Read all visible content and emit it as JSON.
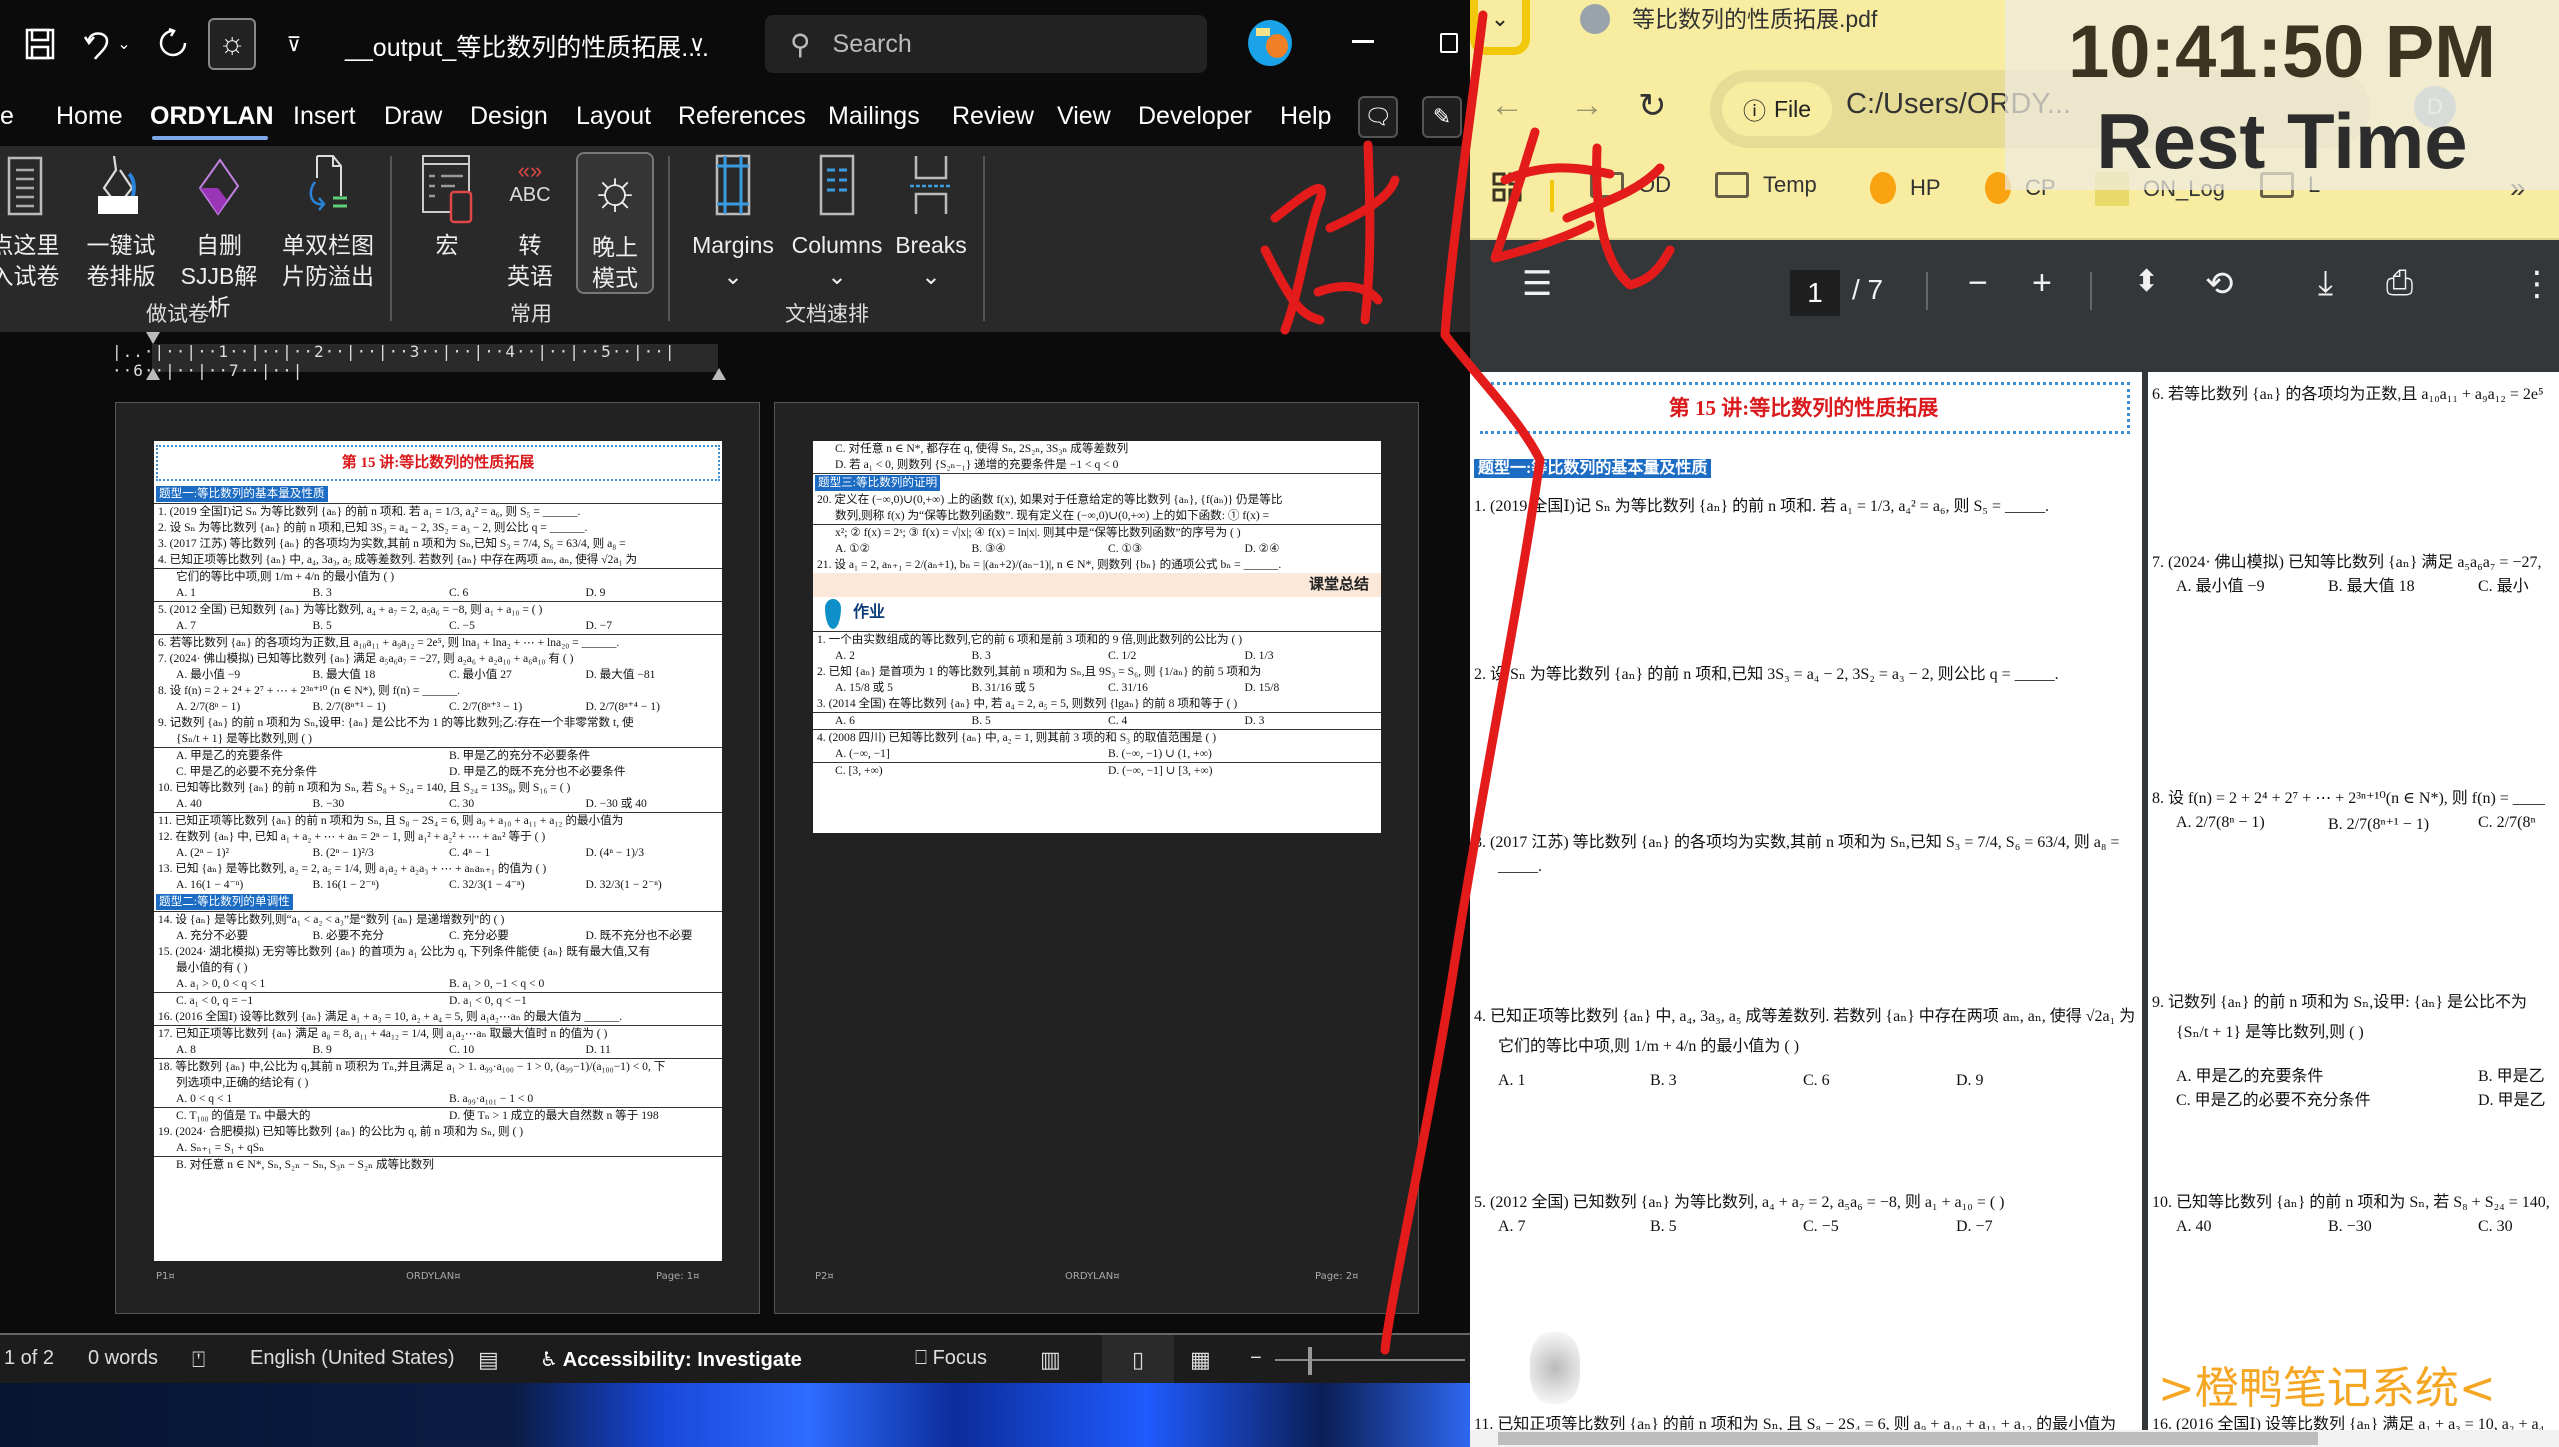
{
  "word": {
    "quick_access": {
      "save_icon": "save-icon",
      "undo_icon": "undo-icon",
      "redo_icon": "redo-icon",
      "sun_icon": "sun-icon",
      "customize_icon": "customize-icon"
    },
    "title": "__output_等比数列的性质拓展....",
    "search_placeholder": "Search",
    "menu": [
      "e",
      "Home",
      "ORDYLAN",
      "Insert",
      "Draw",
      "Design",
      "Layout",
      "References",
      "Mailings",
      "Review",
      "View",
      "Developer",
      "Help"
    ],
    "active_menu": "ORDYLAN",
    "ribbon": {
      "groups": [
        {
          "label": "做试卷",
          "buttons": [
            {
              "line1": "点这里",
              "line2": "入试卷"
            },
            {
              "line1": "一键试",
              "line2": "卷排版"
            },
            {
              "line1": "自删",
              "line2": "SJJB解析"
            },
            {
              "line1": "单双栏图",
              "line2": "片防溢出"
            }
          ]
        },
        {
          "label": "常用",
          "buttons": [
            {
              "line1": "宏",
              "line2": ""
            },
            {
              "line1": "转",
              "line2": "英语"
            },
            {
              "line1": "晚上",
              "line2": "模式"
            }
          ]
        },
        {
          "label": "文档速排",
          "buttons": [
            {
              "line1": "Margins",
              "line2": "⌄"
            },
            {
              "line1": "Columns",
              "line2": "⌄"
            },
            {
              "line1": "Breaks",
              "line2": "⌄"
            }
          ]
        }
      ]
    },
    "ruler_text": "|..·|··|··1··|··|··2··|··|··3··|··|··4··|··|··5··|··|··6··|··|··7··|··|",
    "page1": {
      "header": "第 15 讲:等比数列的性质拓展",
      "section1": "题型一:等比数列的基本量及性质",
      "lines": [
        "1. (2019 全国Ⅰ)记 Sₙ 为等比数列 {aₙ} 的前 n 项和. 若 a₁ = 1/3, a₄² = a₆, 则 S₅ = ______.",
        "2. 设 Sₙ 为等比数列 {aₙ} 的前 n 项和,已知 3S₃ = a₄ − 2, 3S₂ = a₃ − 2, 则公比 q = ______.",
        "3. (2017 江苏) 等比数列 {aₙ} 的各项均为实数,其前 n 项和为 Sₙ,已知 S₃ = 7/4, S₆ = 63/4, 则 a₈ =",
        "4. 已知正项等比数列 {aₙ} 中, a₄, 3a₃, a₅ 成等差数列. 若数列 {aₙ} 中存在两项 aₘ, aₙ, 使得 √2a₁ 为",
        "它们的等比中项,则 1/m + 4/n 的最小值为 (   )"
      ],
      "q4_opts": [
        "A. 1",
        "B. 3",
        "C. 6",
        "D. 9"
      ],
      "q5": "5. (2012 全国) 已知数列 {aₙ} 为等比数列, a₄ + a₇ = 2, a₅a₆ = −8, 则 a₁ + a₁₀ = (   )",
      "q5_opts": [
        "A. 7",
        "B. 5",
        "C. −5",
        "D. −7"
      ],
      "q6": "6. 若等比数列 {aₙ} 的各项均为正数,且 a₁₀a₁₁ + a₉a₁₂ = 2e⁵, 则 lna₁ + lna₂ + ⋯ + lna₂₀ = ______.",
      "q7": "7. (2024· 佛山模拟) 已知等比数列 {aₙ} 满足 a₅a₆a₇ = −27, 则 a₂a₆ + a₂a₁₀ + a₆a₁₀ 有 (   )",
      "q7_opts": [
        "A. 最小值 −9",
        "B. 最大值 18",
        "C. 最小值 27",
        "D. 最大值 −81"
      ],
      "q8": "8. 设 f(n) = 2 + 2⁴ + 2⁷ + ⋯ + 2³ⁿ⁺¹⁰ (n ∈ N*), 则 f(n) = ______.",
      "q8_opts": [
        "A. 2/7(8ⁿ − 1)",
        "B. 2/7(8ⁿ⁺¹ − 1)",
        "C. 2/7(8ⁿ⁺³ − 1)",
        "D. 2/7(8ⁿ⁺⁴ − 1)"
      ],
      "q9a": "9. 记数列 {aₙ} 的前 n 项和为 Sₙ,设甲: {aₙ} 是公比不为 1 的等比数列;乙:存在一个非零常数 t, 使",
      "q9b": "{Sₙ/t + 1} 是等比数列,则 (   )",
      "q9_opts": [
        "A. 甲是乙的充要条件",
        "B. 甲是乙的充分不必要条件",
        "C. 甲是乙的必要不充分条件",
        "D. 甲是乙的既不充分也不必要条件"
      ],
      "q10": "10. 已知等比数列 {aₙ} 的前 n 项和为 Sₙ, 若 S₈ + S₂₄ = 140, 且 S₂₄ = 13S₈, 则 S₁₆ = (   )",
      "q10_opts": [
        "A. 40",
        "B. −30",
        "C. 30",
        "D. −30 或 40"
      ],
      "q11": "11. 已知正项等比数列 {aₙ} 的前 n 项和为 Sₙ, 且 S₈ − 2S₄ = 6, 则 a₉ + a₁₀ + a₁₁ + a₁₂ 的最小值为",
      "q12": "12. 在数列 {aₙ} 中, 已知 a₁ + a₂ + ⋯ + aₙ = 2ⁿ − 1, 则 a₁² + a₂² + ⋯ + aₙ² 等于 (   )",
      "q12_opts": [
        "A. (2ⁿ − 1)²",
        "B. (2ⁿ − 1)²/3",
        "C. 4ⁿ − 1",
        "D. (4ⁿ − 1)/3"
      ],
      "q13": "13. 已知 {aₙ} 是等比数列, a₂ = 2, a₅ = 1/4, 则 a₁a₂ + a₂a₃ + ⋯ + aₙaₙ₊₁ 的值为 (   )",
      "q13_opts": [
        "A. 16(1 − 4⁻ⁿ)",
        "B. 16(1 − 2⁻ⁿ)",
        "C. 32/3(1 − 4⁻ⁿ)",
        "D. 32/3(1 − 2⁻ⁿ)"
      ],
      "section2": "题型二:等比数列的单调性",
      "q14": "14. 设 {aₙ} 是等比数列,则“a₁ < a₂ < a₃”是“数列 {aₙ} 是递增数列”的 (   )",
      "q14_opts": [
        "A. 充分不必要",
        "B. 必要不充分",
        "C. 充分必要",
        "D. 既不充分也不必要"
      ],
      "q15a": "15. (2024· 湖北模拟) 无穷等比数列 {aₙ} 的首项为 a₁ 公比为 q, 下列条件能使 {aₙ} 既有最大值,又有",
      "q15b": "最小值的有 (   )",
      "q15_opts": [
        "A. a₁ > 0, 0 < q < 1",
        "B. a₁ > 0, −1 < q < 0",
        "C. a₁ < 0, q = −1",
        "D. a₁ < 0, q < −1"
      ],
      "q16": "16. (2016 全国Ⅰ) 设等比数列 {aₙ} 满足 a₁ + a₃ = 10, a₂ + a₄ = 5, 则 a₁a₂⋯aₙ 的最大值为 ______.",
      "q17": "17. 已知正项等比数列 {aₙ} 满足 a₈ = 8, a₁₁ + 4a₁₂ = 1/4, 则 a₁a₂⋯aₙ 取最大值时 n 的值为 (   )",
      "q17_opts": [
        "A. 8",
        "B. 9",
        "C. 10",
        "D. 11"
      ],
      "q18a": "18. 等比数列 {aₙ} 中,公比为 q,其前 n 项积为 Tₙ,并且满足 a₁ > 1. a₉₉·a₁₀₀ − 1 > 0, (a₉₉−1)/(a₁₀₀−1) < 0, 下",
      "q18b": "列选项中,正确的结论有 (   )",
      "q18_opts": [
        "A. 0 < q < 1",
        "B. a₉₉·a₁₀₁ − 1 < 0",
        "C. T₁₀₀ 的值是 Tₙ 中最大的",
        "D. 使 Tₙ > 1 成立的最大自然数 n 等于 198"
      ],
      "q19": "19. (2024· 合肥模拟) 已知等比数列 {aₙ} 的公比为 q, 前 n 项和为 Sₙ, 则 (   )",
      "q19a": "A. Sₙ₊₁ = S₁ + qSₙ",
      "q19b": "B. 对任意 n ∈ N*, Sₙ, S₂ₙ − Sₙ, S₃ₙ − S₂ₙ 成等比数列",
      "footer_left": "P1¤",
      "footer_center": "ORDYLAN¤",
      "footer_right": "Page: 1¤"
    },
    "page2": {
      "l1": "C. 对任意 n ∈ N*, 都存在 q, 使得 Sₙ, 2S₂ₙ, 3S₃ₙ 成等差数列",
      "l2": "D. 若 a₁ < 0, 则数列 {S₂ₙ₋₁} 递增的充要条件是 −1 < q < 0",
      "section3": "题型三:等比数列的证明",
      "q20a": "20. 定义在 (−∞,0)∪(0,+∞) 上的函数 f(x), 如果对于任意给定的等比数列 {aₙ}, {f(aₙ)} 仍是等比",
      "q20b": "数列,则称 f(x) 为“保等比数列函数”. 现有定义在 (−∞,0)∪(0,+∞) 上的如下函数: ① f(x) =",
      "q20c": "x²; ② f(x) = 2ˣ; ③ f(x) = √|x|; ④ f(x) = ln|x|. 则其中是“保等比数列函数”的序号为 (   )",
      "q20_opts": [
        "A. ①②",
        "B. ③④",
        "C. ①③",
        "D. ②④"
      ],
      "q21": "21. 设 a₁ = 2, aₙ₊₁ = 2/(aₙ+1), bₙ = |(aₙ+2)/(aₙ−1)|, n ∈ N*, 则数列 {bₙ} 的通项公式 bₙ = ______.",
      "summary": "课堂总结",
      "homework": "作业",
      "h1": "1. 一个由实数组成的等比数列,它的前 6 项和是前 3 项和的 9 倍,则此数列的公比为 (   )",
      "h1_opts": [
        "A. 2",
        "B. 3",
        "C. 1/2",
        "D. 1/3"
      ],
      "h2": "2. 已知 {aₙ} 是首项为 1 的等比数列,其前 n 项和为 Sₙ,且 9S₃ = S₆, 则 {1/aₙ} 的前 5 项和为",
      "h2_opts": [
        "A. 15/8 或 5",
        "B. 31/16 或 5",
        "C. 31/16",
        "D. 15/8"
      ],
      "h3": "3. (2014 全国) 在等比数列 {aₙ} 中, 若 a₄ = 2, a₅ = 5, 则数列 {lgaₙ} 的前 8 项和等于 (   )",
      "h3_opts": [
        "A. 6",
        "B. 5",
        "C. 4",
        "D. 3"
      ],
      "h4": "4. (2008 四川) 已知等比数列 {aₙ} 中, a₂ = 1, 则其前 3 项的和 S₃ 的取值范围是 (   )",
      "h4_opts": [
        "A. (−∞, −1]",
        "B. (−∞, −1) ∪ (1, +∞)",
        "C. [3, +∞)",
        "D. (−∞, −1] ∪ [3, +∞)"
      ],
      "footer_left": "P2¤",
      "footer_center": "ORDYLAN¤",
      "footer_right": "Page: 2¤"
    },
    "status": {
      "page": "1 of 2",
      "words": "0 words",
      "language": "English (United States)",
      "accessibility": "Accessibility: Investigate",
      "focus": "Focus"
    }
  },
  "browser": {
    "tab_title": "等比数列的性质拓展.pdf",
    "address_chip": "File",
    "address_url": "C:/Users/ORDY...",
    "profile_initial": "D",
    "bookmarks": [
      "OD",
      "Temp",
      "HP",
      "CP",
      "ON_Log",
      "L"
    ],
    "more_bookmarks": "»"
  },
  "overlay": {
    "time": "10:41:50 PM",
    "label": "Rest Time"
  },
  "pdf": {
    "current_page": "1",
    "total_pages": "/ 7",
    "page_left": {
      "header": "第 15 讲:等比数列的性质拓展",
      "section1": "题型一:等比数列的基本量及性质",
      "q1": "1. (2019 全国Ⅰ)记 Sₙ 为等比数列 {aₙ} 的前 n 项和. 若 a₁ = 1/3, a₄² = a₆, 则 S₅ = _____.",
      "q2": "2. 设 Sₙ 为等比数列 {aₙ} 的前 n 项和,已知 3S₃ = a₄ − 2, 3S₂ = a₃ − 2, 则公比 q = _____.",
      "q3": "3. (2017 江苏) 等比数列 {aₙ} 的各项均为实数,其前 n 项和为 Sₙ,已知 S₃ = 7/4, S₆ = 63/4, 则 a₈ =",
      "q3_blank": "_____.",
      "q4": "4. 已知正项等比数列 {aₙ} 中, a₄, 3a₃, a₅ 成等差数列. 若数列 {aₙ} 中存在两项 aₘ, aₙ, 使得 √2a₁ 为",
      "q4b": "它们的等比中项,则 1/m + 4/n 的最小值为 (   )",
      "q4_opts": [
        "A. 1",
        "B. 3",
        "C. 6",
        "D. 9"
      ],
      "q5": "5. (2012 全国) 已知数列 {aₙ} 为等比数列, a₄ + a₇ = 2, a₅a₆ = −8, 则 a₁ + a₁₀ = (   )",
      "q5_opts": [
        "A. 7",
        "B. 5",
        "C. −5",
        "D. −7"
      ],
      "q11": "11. 已知正项等比数列 {aₙ} 的前 n 项和为 Sₙ, 且 S₈ − 2S₄ = 6, 则 a₉ + a₁₀ + a₁₁ + a₁₂ 的最小值为"
    },
    "page_right": {
      "q6": "6. 若等比数列 {aₙ} 的各项均为正数,且 a₁₀a₁₁ + a₉a₁₂ = 2e⁵",
      "q7": "7. (2024· 佛山模拟) 已知等比数列 {aₙ} 满足 a₅a₆a₇ = −27,",
      "q7_opts": [
        "A. 最小值 −9",
        "B. 最大值 18",
        "C. 最小"
      ],
      "q8": "8. 设 f(n) = 2 + 2⁴ + 2⁷ + ⋯ + 2³ⁿ⁺¹⁰(n ∈ N*), 则 f(n) = ____",
      "q8_opts": [
        "A. 2/7(8ⁿ − 1)",
        "B. 2/7(8ⁿ⁺¹ − 1)",
        "C. 2/7(8ⁿ"
      ],
      "q9": "9. 记数列 {aₙ} 的前 n 项和为 Sₙ,设甲: {aₙ} 是公比不为",
      "q9b": "{Sₙ/t + 1} 是等比数列,则 (   )",
      "q9_opts": [
        "A. 甲是乙的充要条件",
        "B. 甲是乙",
        "C. 甲是乙的必要不充分条件",
        "D. 甲是乙"
      ],
      "q10": "10. 已知等比数列 {aₙ} 的前 n 项和为 Sₙ, 若 S₈ + S₂₄ = 140,",
      "q10_opts": [
        "A. 40",
        "B. −30",
        "C. 30"
      ],
      "brand": ">橙鸭笔记系统<",
      "q16": "16. (2016 全国Ⅰ) 设等比数列 {aₙ} 满足 a₁ + a₃ = 10, a₂ + a₄"
    }
  },
  "annotation": {
    "ink_color": "#e31b1b",
    "handwriting": "对比"
  },
  "colors": {
    "accent_blue": "#1c6cc4",
    "header_red": "#d9191c",
    "brand_orange": "#f5a623",
    "browser_theme": "#f8eca0"
  }
}
